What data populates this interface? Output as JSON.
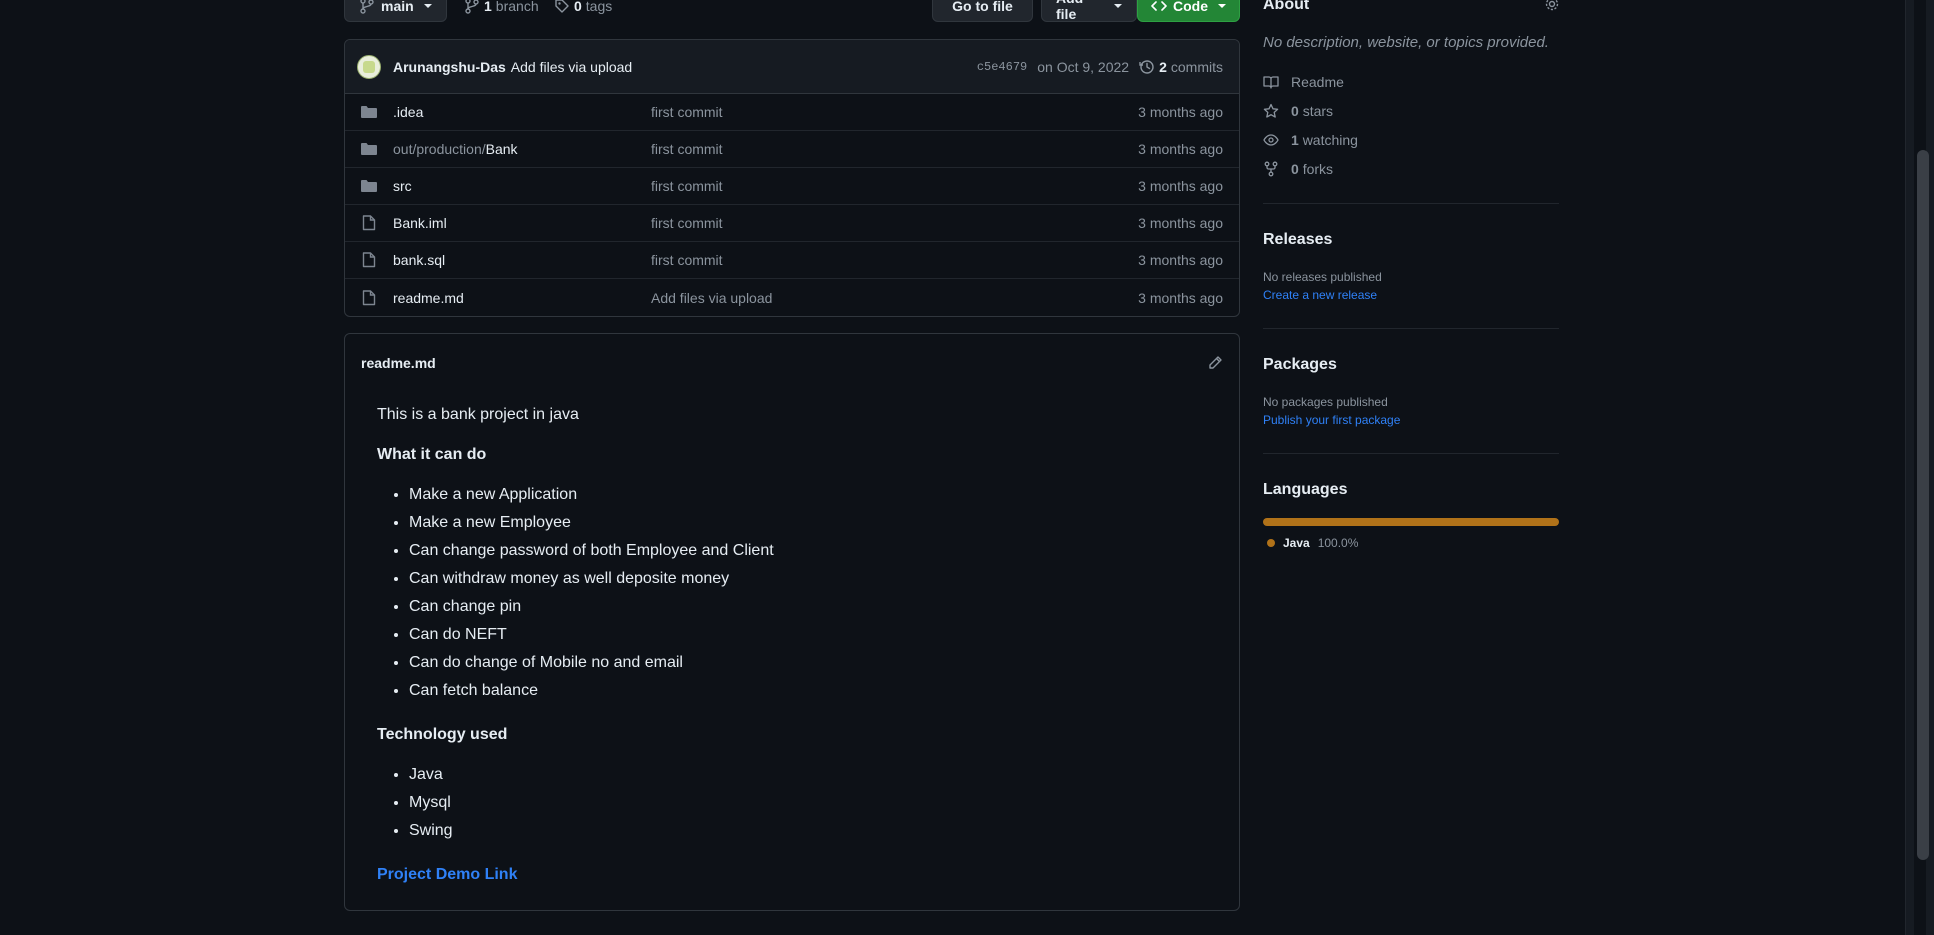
{
  "branchbar": {
    "branch_label": "main",
    "branch_count": "1",
    "branch_text": "branch",
    "tag_count": "0",
    "tag_text": "tags",
    "goto_label": "Go to file",
    "addfile_label": "Add file",
    "code_label": "Code"
  },
  "commit": {
    "author": "Arunangshu-Das",
    "message": "Add files via upload",
    "sha": "c5e4679",
    "date": "on Oct 9, 2022",
    "count": "2",
    "count_label": "commits"
  },
  "files": [
    {
      "name": "",
      "name_main": ".idea",
      "message": "first commit",
      "age": "3 months ago",
      "icon": "folder-icon"
    },
    {
      "name_prefix": "out/production/",
      "name_main": "Bank",
      "message": "first commit",
      "age": "3 months ago",
      "icon": "folder-icon"
    },
    {
      "name_main": "src",
      "message": "first commit",
      "age": "3 months ago",
      "icon": "folder-icon"
    },
    {
      "name_main": "Bank.iml",
      "message": "first commit",
      "age": "3 months ago",
      "icon": "file-icon"
    },
    {
      "name_main": "bank.sql",
      "message": "first commit",
      "age": "3 months ago",
      "icon": "file-icon"
    },
    {
      "name_main": "readme.md",
      "message": "Add files via upload",
      "age": "3 months ago",
      "icon": "file-icon"
    }
  ],
  "readme": {
    "title": "readme.md",
    "intro": "This is a bank project in java",
    "heading1": "What it can do",
    "features": [
      "Make a new Application",
      "Make a new Employee",
      "Can change password of both Employee and Client",
      "Can withdraw money as well deposite money",
      "Can change pin",
      "Can do NEFT",
      "Can do change of Mobile no and email",
      "Can fetch balance"
    ],
    "heading2": "Technology used",
    "tech": [
      "Java",
      "Mysql",
      "Swing"
    ],
    "demo_link": "Project Demo Link"
  },
  "sidebar": {
    "about_title": "About",
    "about_desc": "No description, website, or topics provided.",
    "readme_label": "Readme",
    "stars_count": "0",
    "stars_label": "stars",
    "watching_count": "1",
    "watching_label": "watching",
    "forks_count": "0",
    "forks_label": "forks",
    "releases_title": "Releases",
    "releases_none": "No releases published",
    "releases_link": "Create a new release",
    "packages_title": "Packages",
    "packages_none": "No packages published",
    "packages_link": "Publish your first package",
    "languages_title": "Languages",
    "language_name": "Java",
    "language_pct": "100.0%",
    "language_color": "#b07219"
  },
  "colors": {
    "accent_green": "#238636",
    "link_blue": "#2f81f7",
    "background": "#0d1117"
  }
}
